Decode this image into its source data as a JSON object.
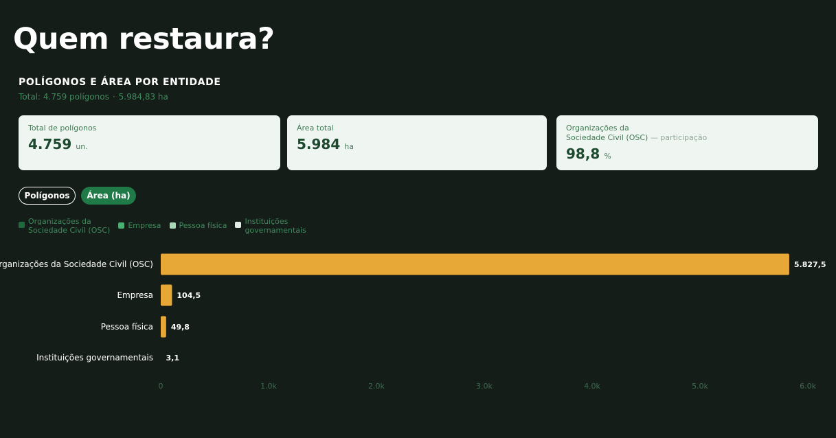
{
  "page": {
    "title": "Quem restaura?"
  },
  "section": {
    "title": "POLÍGONOS E ÁREA POR ENTIDADE",
    "subtitle_polygons": "Total: 4.759 polígonos",
    "subtitle_sep": "·",
    "subtitle_area": "5.984,83 ha"
  },
  "cards": [
    {
      "label": "Total de polígonos",
      "value": "4.759",
      "unit": "un."
    },
    {
      "label": "Área total",
      "value": "5.984",
      "unit": "ha"
    },
    {
      "label_main": "Organizações da\nSociedade Civil (OSC)",
      "label_dash": " — ",
      "label_extra": "participação",
      "value": "98,8",
      "unit": "%"
    }
  ],
  "toggles": {
    "polygons": "Polígonos",
    "area": "Área (ha)"
  },
  "legend": [
    {
      "label": "Organizações da\nSociedade Civil (OSC)",
      "color": "#1f6b3d"
    },
    {
      "label": "Empresa",
      "color": "#4caf72"
    },
    {
      "label": "Pessoa física",
      "color": "#a8d8b5"
    },
    {
      "label": "Instituições\ngovernamentais",
      "color": "#e3ece6"
    }
  ],
  "colors": {
    "bar": "#e8a838",
    "axis_text": "#3f6b50",
    "accent": "#1f7a48"
  },
  "chart_data": {
    "type": "bar",
    "orientation": "horizontal",
    "categories": [
      "Organizações da Sociedade Civil (OSC)",
      "Empresa",
      "Pessoa física",
      "Instituições governamentais"
    ],
    "values": [
      5827.5,
      104.5,
      49.8,
      3.1
    ],
    "value_labels": [
      "5.827,5",
      "104,5",
      "49,8",
      "3,1"
    ],
    "xlim": [
      0,
      6000
    ],
    "xticks": [
      0,
      1000,
      2000,
      3000,
      4000,
      5000,
      6000
    ],
    "xtick_labels": [
      "0",
      "1.0k",
      "2.0k",
      "3.0k",
      "4.0k",
      "5.0k",
      "6.0k"
    ],
    "grid": false
  }
}
